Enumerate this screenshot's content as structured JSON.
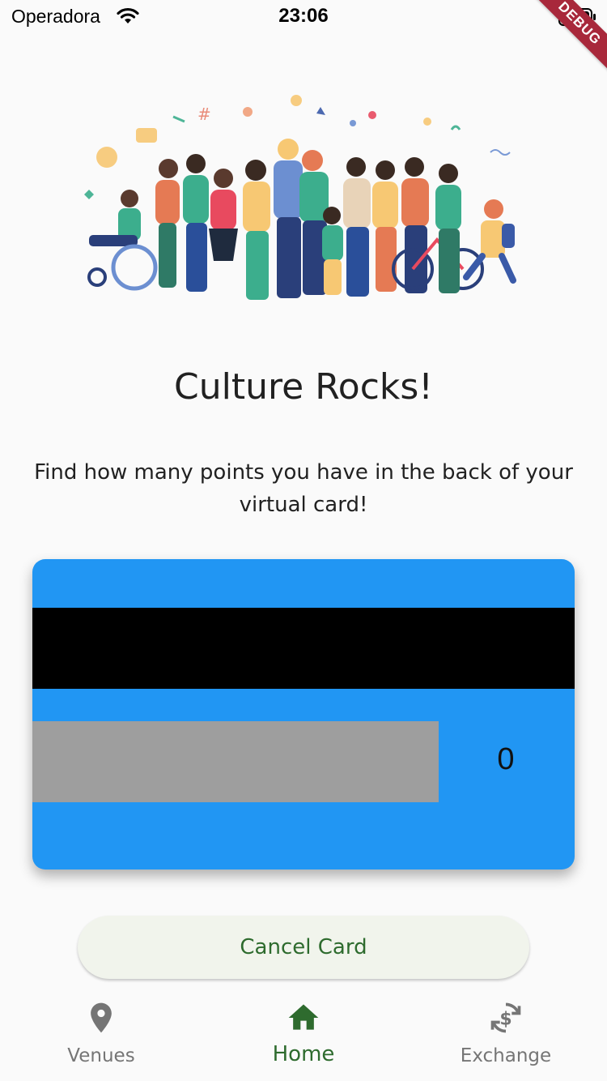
{
  "status_bar": {
    "carrier": "Operadora",
    "time": "23:06"
  },
  "debug_banner": "DEBUG",
  "headline": "Culture Rocks!",
  "subtitle": "Find how many points you have in the back of your virtual card!",
  "card": {
    "points": "0",
    "color": "#2196f3"
  },
  "cancel_button": {
    "label": "Cancel Card"
  },
  "bottom_nav": {
    "items": [
      {
        "label": "Venues",
        "icon": "location-pin-icon",
        "active": false
      },
      {
        "label": "Home",
        "icon": "home-icon",
        "active": true
      },
      {
        "label": "Exchange",
        "icon": "currency-exchange-icon",
        "active": false
      }
    ],
    "active_color": "#2e6b2e",
    "inactive_color": "#757575"
  }
}
